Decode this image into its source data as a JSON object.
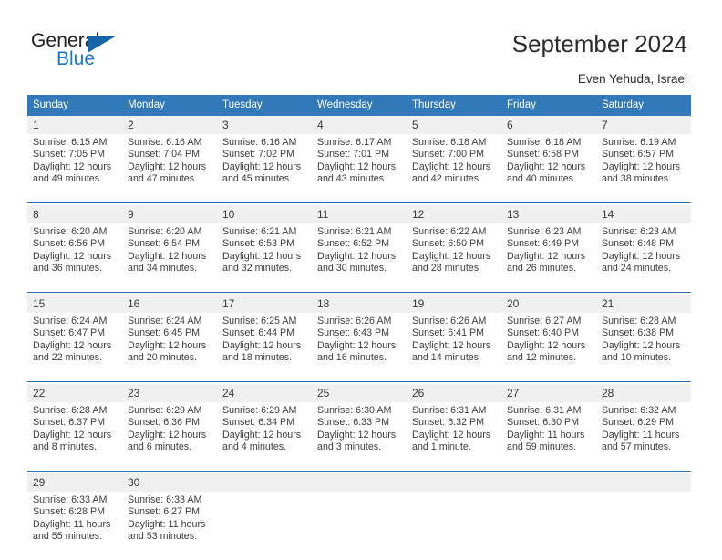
{
  "brand": {
    "name_top": "General",
    "name_bottom": "Blue",
    "accent_color": "#1b78c2",
    "triangle_color": "#1565a8"
  },
  "header": {
    "title": "September 2024",
    "location": "Even Yehuda, Israel"
  },
  "calendar": {
    "header_bg": "#3179b8",
    "header_text_color": "#ffffff",
    "daynum_bg": "#f0f0f0",
    "separator_color": "#2f6fae",
    "weekdays": [
      "Sunday",
      "Monday",
      "Tuesday",
      "Wednesday",
      "Thursday",
      "Friday",
      "Saturday"
    ],
    "weeks": [
      [
        {
          "day": "1",
          "sunrise": "Sunrise: 6:15 AM",
          "sunset": "Sunset: 7:05 PM",
          "daylight_1": "Daylight: 12 hours",
          "daylight_2": "and 49 minutes."
        },
        {
          "day": "2",
          "sunrise": "Sunrise: 6:16 AM",
          "sunset": "Sunset: 7:04 PM",
          "daylight_1": "Daylight: 12 hours",
          "daylight_2": "and 47 minutes."
        },
        {
          "day": "3",
          "sunrise": "Sunrise: 6:16 AM",
          "sunset": "Sunset: 7:02 PM",
          "daylight_1": "Daylight: 12 hours",
          "daylight_2": "and 45 minutes."
        },
        {
          "day": "4",
          "sunrise": "Sunrise: 6:17 AM",
          "sunset": "Sunset: 7:01 PM",
          "daylight_1": "Daylight: 12 hours",
          "daylight_2": "and 43 minutes."
        },
        {
          "day": "5",
          "sunrise": "Sunrise: 6:18 AM",
          "sunset": "Sunset: 7:00 PM",
          "daylight_1": "Daylight: 12 hours",
          "daylight_2": "and 42 minutes."
        },
        {
          "day": "6",
          "sunrise": "Sunrise: 6:18 AM",
          "sunset": "Sunset: 6:58 PM",
          "daylight_1": "Daylight: 12 hours",
          "daylight_2": "and 40 minutes."
        },
        {
          "day": "7",
          "sunrise": "Sunrise: 6:19 AM",
          "sunset": "Sunset: 6:57 PM",
          "daylight_1": "Daylight: 12 hours",
          "daylight_2": "and 38 minutes."
        }
      ],
      [
        {
          "day": "8",
          "sunrise": "Sunrise: 6:20 AM",
          "sunset": "Sunset: 6:56 PM",
          "daylight_1": "Daylight: 12 hours",
          "daylight_2": "and 36 minutes."
        },
        {
          "day": "9",
          "sunrise": "Sunrise: 6:20 AM",
          "sunset": "Sunset: 6:54 PM",
          "daylight_1": "Daylight: 12 hours",
          "daylight_2": "and 34 minutes."
        },
        {
          "day": "10",
          "sunrise": "Sunrise: 6:21 AM",
          "sunset": "Sunset: 6:53 PM",
          "daylight_1": "Daylight: 12 hours",
          "daylight_2": "and 32 minutes."
        },
        {
          "day": "11",
          "sunrise": "Sunrise: 6:21 AM",
          "sunset": "Sunset: 6:52 PM",
          "daylight_1": "Daylight: 12 hours",
          "daylight_2": "and 30 minutes."
        },
        {
          "day": "12",
          "sunrise": "Sunrise: 6:22 AM",
          "sunset": "Sunset: 6:50 PM",
          "daylight_1": "Daylight: 12 hours",
          "daylight_2": "and 28 minutes."
        },
        {
          "day": "13",
          "sunrise": "Sunrise: 6:23 AM",
          "sunset": "Sunset: 6:49 PM",
          "daylight_1": "Daylight: 12 hours",
          "daylight_2": "and 26 minutes."
        },
        {
          "day": "14",
          "sunrise": "Sunrise: 6:23 AM",
          "sunset": "Sunset: 6:48 PM",
          "daylight_1": "Daylight: 12 hours",
          "daylight_2": "and 24 minutes."
        }
      ],
      [
        {
          "day": "15",
          "sunrise": "Sunrise: 6:24 AM",
          "sunset": "Sunset: 6:47 PM",
          "daylight_1": "Daylight: 12 hours",
          "daylight_2": "and 22 minutes."
        },
        {
          "day": "16",
          "sunrise": "Sunrise: 6:24 AM",
          "sunset": "Sunset: 6:45 PM",
          "daylight_1": "Daylight: 12 hours",
          "daylight_2": "and 20 minutes."
        },
        {
          "day": "17",
          "sunrise": "Sunrise: 6:25 AM",
          "sunset": "Sunset: 6:44 PM",
          "daylight_1": "Daylight: 12 hours",
          "daylight_2": "and 18 minutes."
        },
        {
          "day": "18",
          "sunrise": "Sunrise: 6:26 AM",
          "sunset": "Sunset: 6:43 PM",
          "daylight_1": "Daylight: 12 hours",
          "daylight_2": "and 16 minutes."
        },
        {
          "day": "19",
          "sunrise": "Sunrise: 6:26 AM",
          "sunset": "Sunset: 6:41 PM",
          "daylight_1": "Daylight: 12 hours",
          "daylight_2": "and 14 minutes."
        },
        {
          "day": "20",
          "sunrise": "Sunrise: 6:27 AM",
          "sunset": "Sunset: 6:40 PM",
          "daylight_1": "Daylight: 12 hours",
          "daylight_2": "and 12 minutes."
        },
        {
          "day": "21",
          "sunrise": "Sunrise: 6:28 AM",
          "sunset": "Sunset: 6:38 PM",
          "daylight_1": "Daylight: 12 hours",
          "daylight_2": "and 10 minutes."
        }
      ],
      [
        {
          "day": "22",
          "sunrise": "Sunrise: 6:28 AM",
          "sunset": "Sunset: 6:37 PM",
          "daylight_1": "Daylight: 12 hours",
          "daylight_2": "and 8 minutes."
        },
        {
          "day": "23",
          "sunrise": "Sunrise: 6:29 AM",
          "sunset": "Sunset: 6:36 PM",
          "daylight_1": "Daylight: 12 hours",
          "daylight_2": "and 6 minutes."
        },
        {
          "day": "24",
          "sunrise": "Sunrise: 6:29 AM",
          "sunset": "Sunset: 6:34 PM",
          "daylight_1": "Daylight: 12 hours",
          "daylight_2": "and 4 minutes."
        },
        {
          "day": "25",
          "sunrise": "Sunrise: 6:30 AM",
          "sunset": "Sunset: 6:33 PM",
          "daylight_1": "Daylight: 12 hours",
          "daylight_2": "and 3 minutes."
        },
        {
          "day": "26",
          "sunrise": "Sunrise: 6:31 AM",
          "sunset": "Sunset: 6:32 PM",
          "daylight_1": "Daylight: 12 hours",
          "daylight_2": "and 1 minute."
        },
        {
          "day": "27",
          "sunrise": "Sunrise: 6:31 AM",
          "sunset": "Sunset: 6:30 PM",
          "daylight_1": "Daylight: 11 hours",
          "daylight_2": "and 59 minutes."
        },
        {
          "day": "28",
          "sunrise": "Sunrise: 6:32 AM",
          "sunset": "Sunset: 6:29 PM",
          "daylight_1": "Daylight: 11 hours",
          "daylight_2": "and 57 minutes."
        }
      ],
      [
        {
          "day": "29",
          "sunrise": "Sunrise: 6:33 AM",
          "sunset": "Sunset: 6:28 PM",
          "daylight_1": "Daylight: 11 hours",
          "daylight_2": "and 55 minutes."
        },
        {
          "day": "30",
          "sunrise": "Sunrise: 6:33 AM",
          "sunset": "Sunset: 6:27 PM",
          "daylight_1": "Daylight: 11 hours",
          "daylight_2": "and 53 minutes."
        },
        {
          "day": "",
          "sunrise": "",
          "sunset": "",
          "daylight_1": "",
          "daylight_2": ""
        },
        {
          "day": "",
          "sunrise": "",
          "sunset": "",
          "daylight_1": "",
          "daylight_2": ""
        },
        {
          "day": "",
          "sunrise": "",
          "sunset": "",
          "daylight_1": "",
          "daylight_2": ""
        },
        {
          "day": "",
          "sunrise": "",
          "sunset": "",
          "daylight_1": "",
          "daylight_2": ""
        },
        {
          "day": "",
          "sunrise": "",
          "sunset": "",
          "daylight_1": "",
          "daylight_2": ""
        }
      ]
    ]
  }
}
